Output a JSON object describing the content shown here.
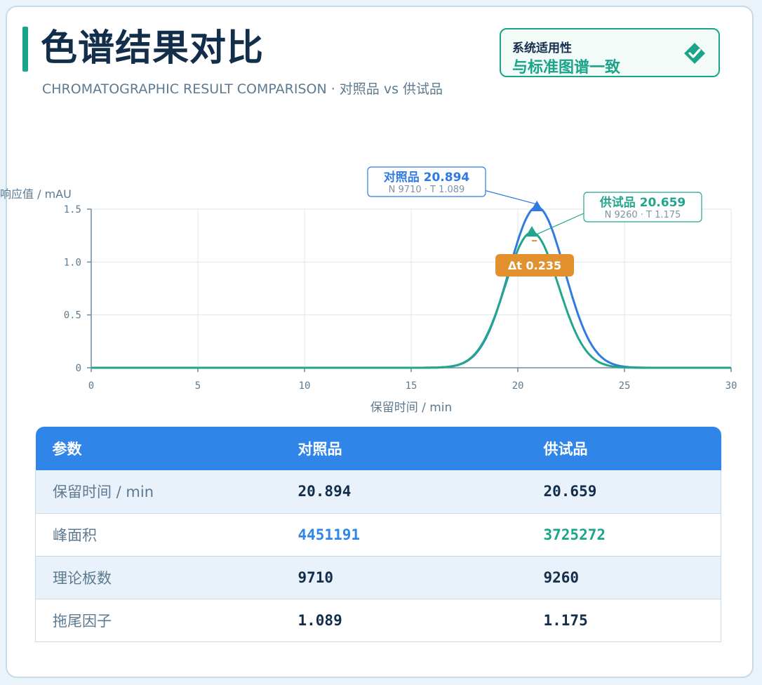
{
  "header": {
    "title": "色谱结果对比",
    "subtitle": "CHROMATOGRAPHIC RESULT COMPARISON · 对照品 vs 供试品"
  },
  "badge": {
    "label": "系统适用性",
    "value": "与标准图谱一致",
    "icon": "diamond-check-icon"
  },
  "colors": {
    "reference": "#2f7be0",
    "sample": "#22a58c",
    "delta": "#e2912e",
    "axis": "#5d7a90",
    "grid": "#dbe7f0"
  },
  "chart_data": {
    "type": "line",
    "xlabel": "保留时间 / min",
    "ylabel": "响应值 / mAU",
    "xlim": [
      0,
      30
    ],
    "ylim": [
      0,
      1.5
    ],
    "xticks": [
      "0",
      "5",
      "10",
      "15",
      "20",
      "25",
      "30"
    ],
    "yticks": [
      "0",
      "0.5",
      "1.0",
      "1.5"
    ],
    "grid": true,
    "series": [
      {
        "name": "对照品",
        "peak_x": 20.894,
        "peak_y": 1.52,
        "sigma": 1.3,
        "annotation": {
          "title": "对照品 20.894",
          "sub": "N 9710 · T 1.089"
        }
      },
      {
        "name": "供试品",
        "peak_x": 20.659,
        "peak_y": 1.28,
        "sigma": 1.25,
        "annotation": {
          "title": "供试品 20.659",
          "sub": "N 9260 · T 1.175"
        }
      }
    ],
    "delta_label": "Δt 0.235"
  },
  "table": {
    "headers": [
      "参数",
      "对照品",
      "供试品"
    ],
    "rows": [
      {
        "label": "保留时间 / min",
        "ref": "20.894",
        "sample": "20.659"
      },
      {
        "label": "峰面积",
        "ref": "4451191",
        "sample": "3725272"
      },
      {
        "label": "理论板数",
        "ref": "9710",
        "sample": "9260"
      },
      {
        "label": "拖尾因子",
        "ref": "1.089",
        "sample": "1.175"
      }
    ]
  }
}
